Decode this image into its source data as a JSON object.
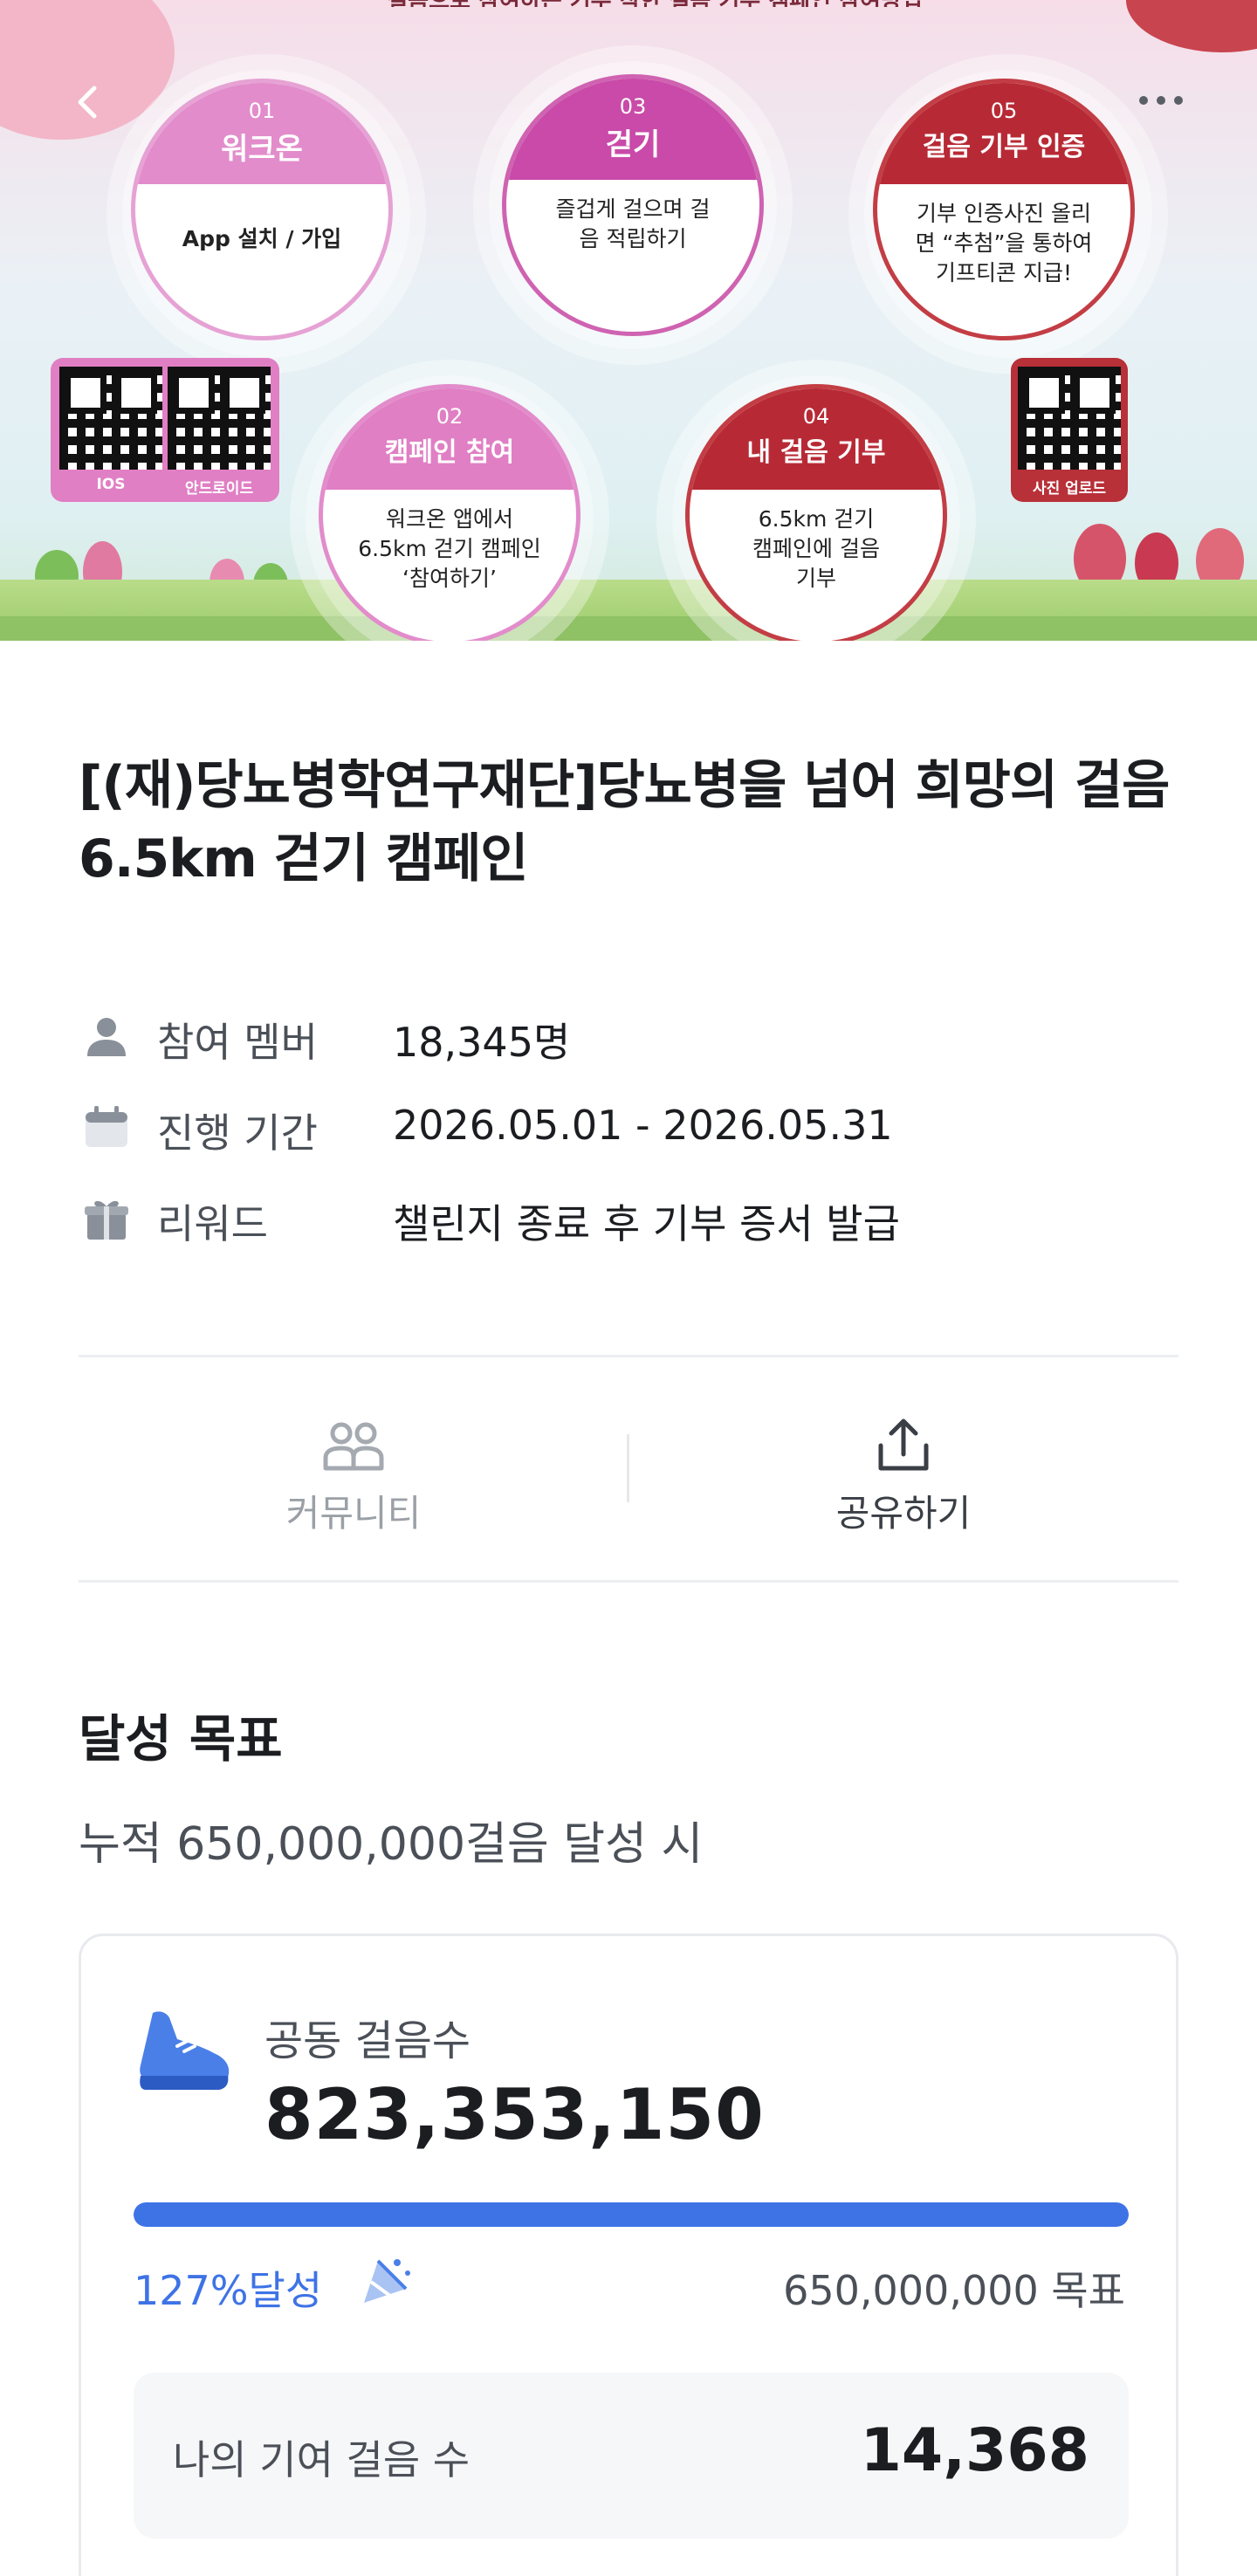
{
  "banner": {
    "top_text": "걸음으로 참여하는 기부 착한 걸음 기부 캠페인 참여방법",
    "steps": [
      {
        "num": "01",
        "title": "워크온",
        "body": "App 설치 / 가입"
      },
      {
        "num": "03",
        "title": "걷기",
        "body": "즐겁게 걸으며 걸음 적립하기"
      },
      {
        "num": "05",
        "title": "걸음 기부 인증",
        "body": "기부 인증사진 올리면 “추첨”을 통하여 기프티콘 지급!"
      },
      {
        "num": "02",
        "title": "캠페인 참여",
        "body": "워크온 앱에서 6.5km 걷기 캠페인 ‘참여하기’"
      },
      {
        "num": "04",
        "title": "내 걸음 기부",
        "body": "6.5km 걷기 캠페인에 걸음 기부"
      }
    ],
    "qr_labels": {
      "ios": "IOS",
      "android": "안드로이드",
      "upload": "사진 업로드"
    }
  },
  "campaign": {
    "title": "[(재)당뇨병학연구재단]당뇨병을 넘어 희망의 걸음 6.5km 걷기 캠페인",
    "info": {
      "members_label": "참여 멤버",
      "members_value": "18,345명",
      "period_label": "진행 기간",
      "period_value": "2026.05.01 - 2026.05.31",
      "reward_label": "리워드",
      "reward_value": "챌린지 종료 후 기부 증서 발급"
    }
  },
  "actions": {
    "community_label": "커뮤니티",
    "share_label": "공유하기"
  },
  "goal": {
    "section_title": "달성 목표",
    "subtitle": "누적 650,000,000걸음 달성 시",
    "steps_label": "공동 걸음수",
    "steps_value": "823,353,150",
    "progress_fraction": 1.0,
    "achieve_text": "127%달성",
    "goal_text": "650,000,000 목표",
    "my_contrib_label": "나의 기여 걸음 수",
    "my_contrib_value": "14,368"
  },
  "colors": {
    "accent": "#3e73e6",
    "pink": "#e28ccb",
    "magenta": "#c94aa8",
    "red": "#b72a35"
  },
  "icons": {
    "back": "chevron-left-icon",
    "more": "more-horizontal-icon",
    "members": "person-icon",
    "period": "calendar-icon",
    "reward": "gift-icon",
    "community": "people-icon",
    "share": "share-icon",
    "steps": "shoe-icon",
    "achieve": "party-popper-icon"
  }
}
